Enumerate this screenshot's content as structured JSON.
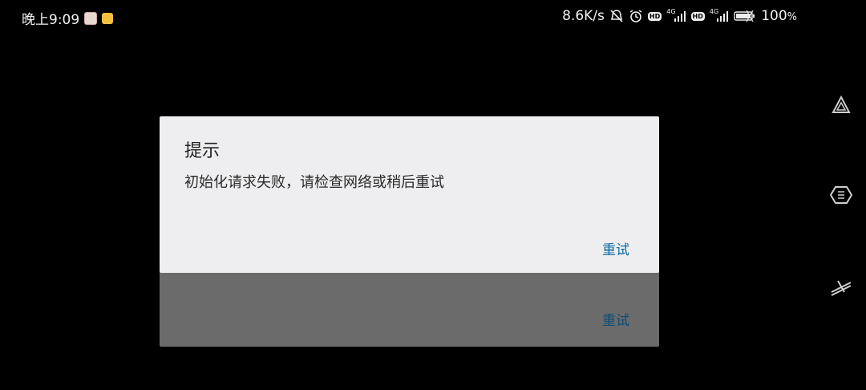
{
  "status_bar": {
    "time": "晚上9:09",
    "net_speed": "8.6K/s",
    "battery_percent": "100",
    "battery_unit": "%",
    "hd_label": "HD",
    "net_type_1": "4G",
    "net_type_2": "4G",
    "icons": [
      "app-notification-icon",
      "gallery-notification-icon",
      "mute-icon",
      "alarm-icon",
      "hd-badge",
      "signal-icon",
      "battery-icon"
    ]
  },
  "dialog": {
    "title": "提示",
    "message": "初始化请求失败，请检查网络或稍后重试",
    "button_label": "重试",
    "background_color": "#eeeef0",
    "button_color": "#0b6aa0"
  },
  "background_dialog": {
    "button_label": "重试",
    "background_color": "#6b6b6b"
  },
  "side_controls": [
    "triangle-logo-icon",
    "gamepad-hex-icon",
    "slash-lines-icon"
  ]
}
